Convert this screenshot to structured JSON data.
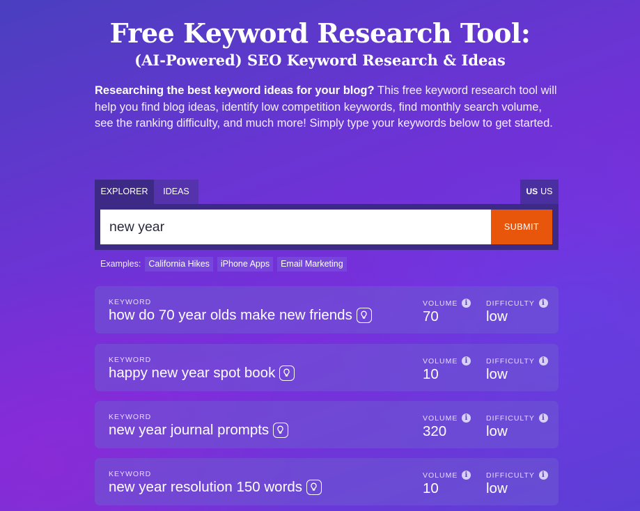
{
  "header": {
    "title": "Free Keyword Research Tool:",
    "subtitle": "(AI-Powered) SEO Keyword Research & Ideas",
    "intro_bold": "Researching the best keyword ideas for your blog?",
    "intro_text": " This free keyword research tool will help you find blog ideas, identify low competition keywords, find monthly search volume, see the ranking difficulty, and much more! Simply type your keywords below to get started."
  },
  "tabs": {
    "explorer": "Explorer",
    "ideas": "Ideas",
    "country_flag": "US",
    "country_code": "US"
  },
  "search": {
    "value": "new year",
    "submit_label": "Submit"
  },
  "examples": {
    "label": "Examples:",
    "items": [
      "California Hikes",
      "iPhone Apps",
      "Email Marketing"
    ]
  },
  "results": [
    {
      "keyword_label": "KEYWORD",
      "keyword": "how do 70 year olds make new friends",
      "volume_label": "VOLUME",
      "volume": "70",
      "difficulty_label": "DIFFICULTY",
      "difficulty": "low"
    },
    {
      "keyword_label": "KEYWORD",
      "keyword": "happy new year spot book",
      "volume_label": "VOLUME",
      "volume": "10",
      "difficulty_label": "DIFFICULTY",
      "difficulty": "low"
    },
    {
      "keyword_label": "KEYWORD",
      "keyword": "new year journal prompts",
      "volume_label": "VOLUME",
      "volume": "320",
      "difficulty_label": "DIFFICULTY",
      "difficulty": "low"
    },
    {
      "keyword_label": "KEYWORD",
      "keyword": "new year resolution 150 words",
      "volume_label": "VOLUME",
      "volume": "10",
      "difficulty_label": "DIFFICULTY",
      "difficulty": "low"
    }
  ],
  "icons": {
    "idea": "lightbulb-icon",
    "info": "info-icon"
  },
  "colors": {
    "accent": "#e8560b",
    "panel": "#3d2a86"
  }
}
